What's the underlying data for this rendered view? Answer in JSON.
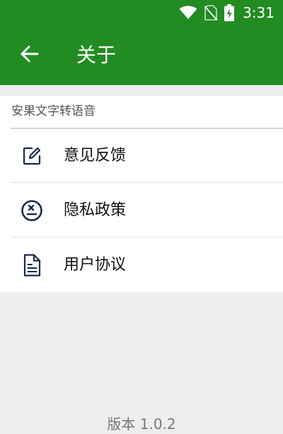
{
  "status_bar": {
    "time": "3:31",
    "icons": [
      "wifi-icon",
      "no-sim-icon",
      "battery-charging-icon"
    ]
  },
  "app_bar": {
    "title": "关于",
    "back_icon": "arrow-left-icon"
  },
  "section": {
    "header": "安果文字转语音",
    "items": [
      {
        "label": "意见反馈",
        "icon": "edit-icon"
      },
      {
        "label": "隐私政策",
        "icon": "privacy-icon"
      },
      {
        "label": "用户协议",
        "icon": "document-icon"
      }
    ]
  },
  "footer": {
    "version": "版本 1.0.2"
  },
  "colors": {
    "primary": "#228b22",
    "icon": "#1a2a4a",
    "background": "#eeeeee"
  }
}
